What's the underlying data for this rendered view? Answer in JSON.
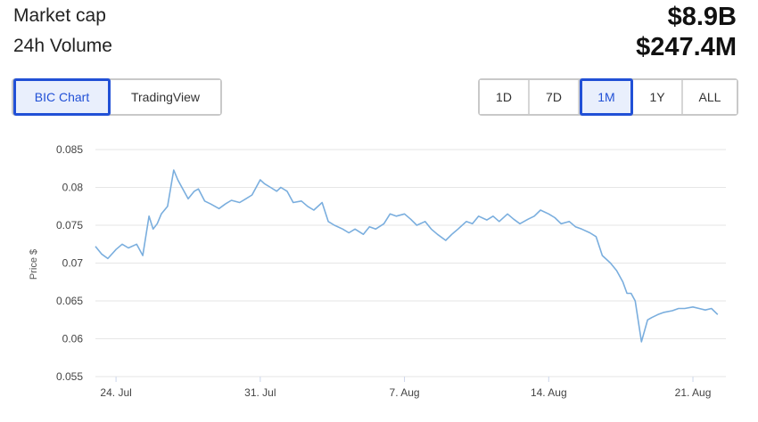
{
  "stats": {
    "market_cap_label": "Market cap",
    "market_cap_value": "$8.9B",
    "volume_label": "24h Volume",
    "volume_value": "$247.4M"
  },
  "chart_type_buttons": [
    {
      "label": "BIC Chart",
      "active": true
    },
    {
      "label": "TradingView",
      "active": false
    }
  ],
  "range_buttons": [
    {
      "label": "1D",
      "active": false
    },
    {
      "label": "7D",
      "active": false
    },
    {
      "label": "1M",
      "active": true
    },
    {
      "label": "1Y",
      "active": false
    },
    {
      "label": "ALL",
      "active": false
    }
  ],
  "colors": {
    "line": "#7aaede",
    "accent": "#2150d6"
  },
  "chart_data": {
    "type": "line",
    "ylabel": "Price $",
    "ylim": [
      0.055,
      0.085
    ],
    "yticks": [
      "0.085",
      "0.08",
      "0.075",
      "0.07",
      "0.065",
      "0.06",
      "0.055"
    ],
    "xticks": [
      "24. Jul",
      "31. Jul",
      "7. Aug",
      "14. Aug",
      "21. Aug"
    ],
    "xtick_days": [
      2,
      9,
      16,
      23,
      30
    ],
    "xlim": [
      1,
      31.6
    ],
    "grid": true,
    "series": [
      {
        "x": [
          1.0,
          1.3,
          1.6,
          2.0,
          2.3,
          2.6,
          3.0,
          3.3,
          3.6,
          3.8,
          4.0,
          4.2,
          4.5,
          4.8,
          5.0,
          5.2,
          5.5,
          5.8,
          6.0,
          6.3,
          6.6,
          7.0,
          7.3,
          7.6,
          8.0,
          8.3,
          8.6,
          9.0,
          9.2,
          9.5,
          9.8,
          10.0,
          10.3,
          10.6,
          11.0,
          11.3,
          11.6,
          12.0,
          12.3,
          12.6,
          13.0,
          13.3,
          13.6,
          14.0,
          14.3,
          14.6,
          15.0,
          15.3,
          15.6,
          16.0,
          16.3,
          16.6,
          17.0,
          17.3,
          17.6,
          18.0,
          18.3,
          18.6,
          19.0,
          19.3,
          19.6,
          20.0,
          20.3,
          20.6,
          21.0,
          21.3,
          21.6,
          22.0,
          22.3,
          22.6,
          23.0,
          23.3,
          23.6,
          24.0,
          24.3,
          24.6,
          25.0,
          25.3,
          25.6,
          26.0,
          26.3,
          26.6,
          26.8,
          27.0,
          27.2,
          27.5,
          27.8,
          28.0,
          28.3,
          28.6,
          29.0,
          29.3,
          29.6,
          30.0,
          30.3,
          30.6,
          30.9,
          31.2
        ],
        "y": [
          0.0722,
          0.0712,
          0.0706,
          0.0718,
          0.0725,
          0.072,
          0.0725,
          0.071,
          0.0762,
          0.0745,
          0.0752,
          0.0765,
          0.0775,
          0.0823,
          0.081,
          0.08,
          0.0785,
          0.0795,
          0.0798,
          0.0782,
          0.0778,
          0.0772,
          0.0778,
          0.0783,
          0.078,
          0.0785,
          0.079,
          0.081,
          0.0805,
          0.08,
          0.0795,
          0.08,
          0.0795,
          0.078,
          0.0782,
          0.0775,
          0.077,
          0.078,
          0.0755,
          0.075,
          0.0745,
          0.074,
          0.0745,
          0.0738,
          0.0748,
          0.0745,
          0.0752,
          0.0765,
          0.0762,
          0.0765,
          0.0758,
          0.075,
          0.0755,
          0.0745,
          0.0738,
          0.073,
          0.0738,
          0.0745,
          0.0755,
          0.0752,
          0.0762,
          0.0757,
          0.0762,
          0.0755,
          0.0765,
          0.0758,
          0.0752,
          0.0758,
          0.0762,
          0.077,
          0.0765,
          0.076,
          0.0752,
          0.0755,
          0.0748,
          0.0745,
          0.074,
          0.0735,
          0.071,
          0.07,
          0.069,
          0.0675,
          0.066,
          0.066,
          0.065,
          0.0596,
          0.0625,
          0.0628,
          0.0632,
          0.0635,
          0.0637,
          0.064,
          0.064,
          0.0642,
          0.064,
          0.0638,
          0.064,
          0.0632
        ]
      }
    ]
  }
}
